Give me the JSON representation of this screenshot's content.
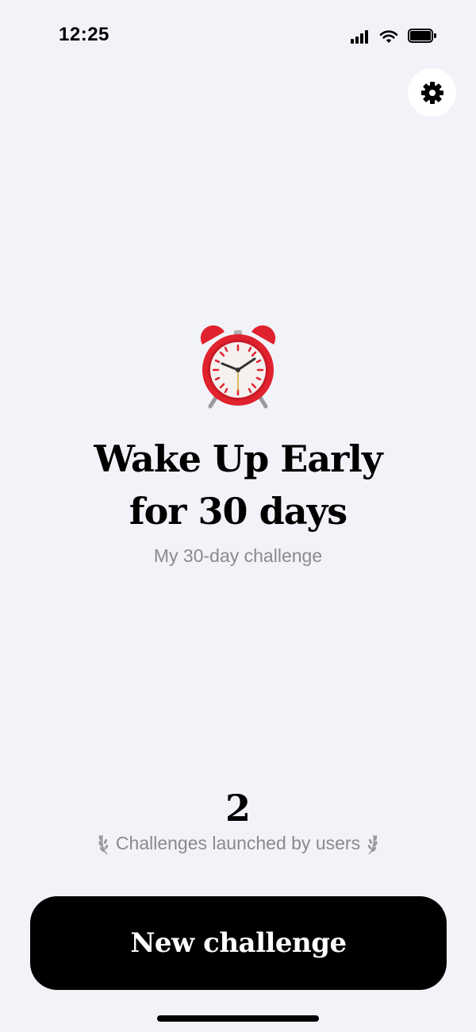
{
  "status_bar": {
    "time": "12:25"
  },
  "icons": {
    "settings": "gear-icon",
    "hero": "alarm-clock-icon",
    "signal": "signal-icon",
    "wifi": "wifi-icon",
    "battery": "battery-icon",
    "laurel": "laurel-icon"
  },
  "challenge": {
    "title_line1": "Wake Up Early",
    "title_line2": "for 30 days",
    "subtitle": "My 30-day challenge"
  },
  "stats": {
    "count": "2",
    "label": "Challenges launched by users"
  },
  "actions": {
    "new_challenge_label": "New challenge"
  },
  "colors": {
    "background": "#f2f3f8",
    "button": "#000000",
    "muted_text": "#8a8a8e",
    "clock_red": "#e0212e"
  }
}
